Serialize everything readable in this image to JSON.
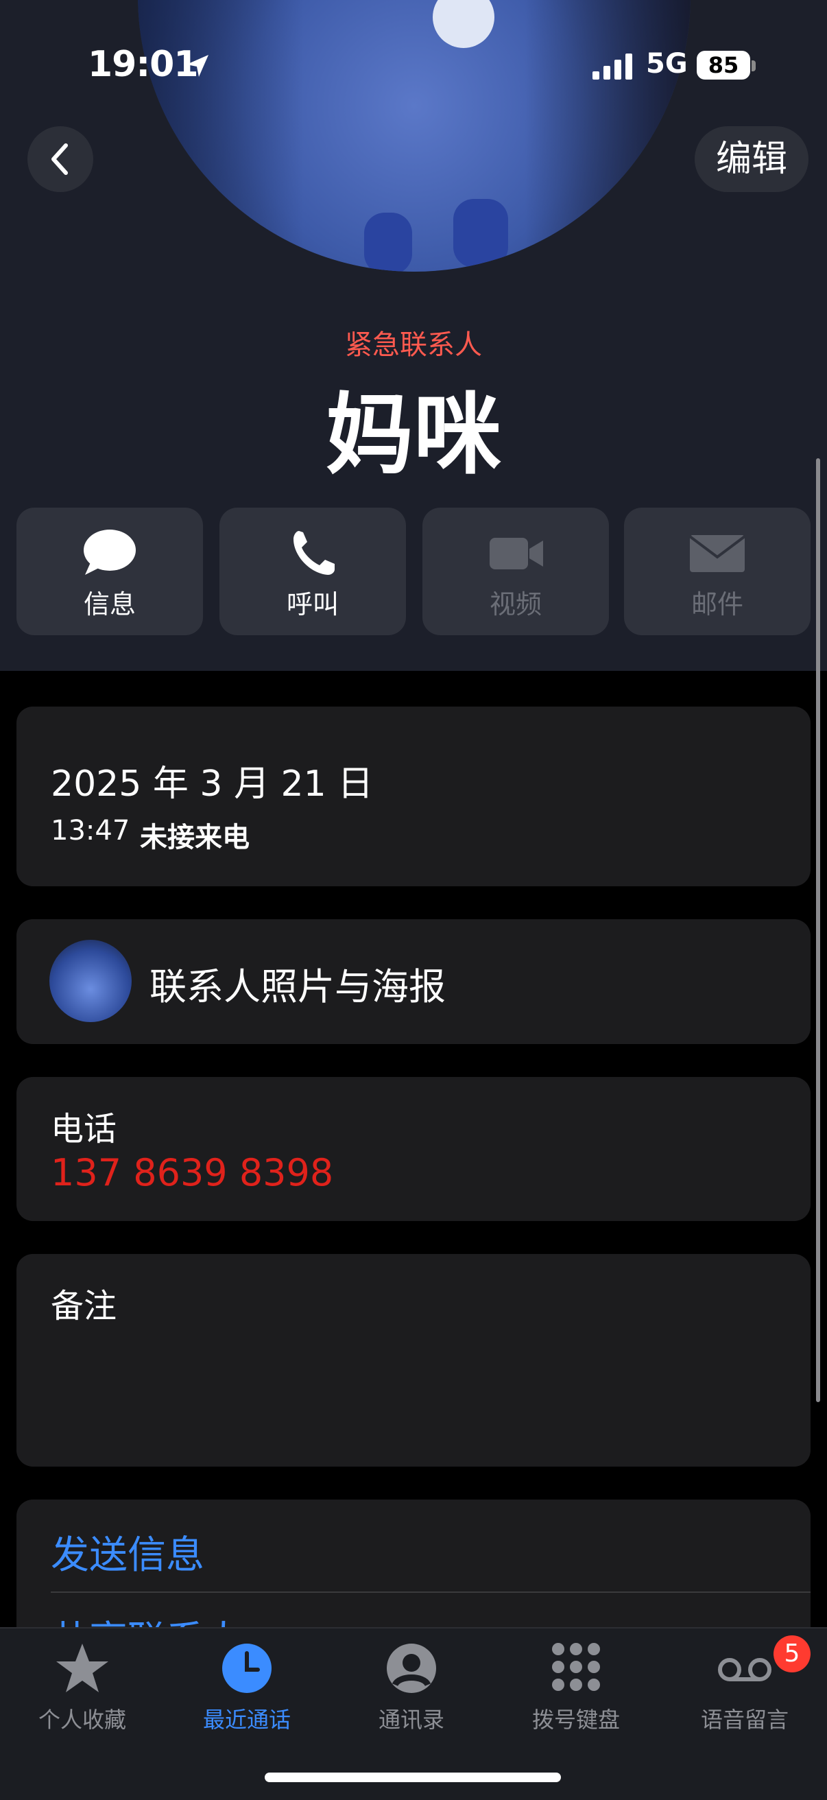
{
  "status_bar": {
    "time": "19:01",
    "network": "5G",
    "battery": "85"
  },
  "header": {
    "edit_label": "编辑",
    "emergency_label": "紧急联系人",
    "contact_name": "妈咪"
  },
  "actions": [
    {
      "label": "信息",
      "icon": "message-bubble-icon",
      "enabled": true
    },
    {
      "label": "呼叫",
      "icon": "phone-icon",
      "enabled": true
    },
    {
      "label": "视频",
      "icon": "video-camera-icon",
      "enabled": false
    },
    {
      "label": "邮件",
      "icon": "mail-icon",
      "enabled": false
    }
  ],
  "call_record": {
    "date": "2025 年 3 月 21 日",
    "time": "13:47",
    "type": "未接来电"
  },
  "photo_poster": {
    "label": "联系人照片与海报"
  },
  "phone": {
    "label": "电话",
    "number": "137 8639 8398",
    "color": "#e0221b"
  },
  "notes": {
    "label": "备注"
  },
  "links": {
    "send_message": "发送信息",
    "share_contact": "共享联系人"
  },
  "tab_bar": {
    "tabs": [
      {
        "label": "个人收藏",
        "icon": "star-icon",
        "active": false
      },
      {
        "label": "最近通话",
        "icon": "clock-icon",
        "active": true
      },
      {
        "label": "通讯录",
        "icon": "person-circle-icon",
        "active": false
      },
      {
        "label": "拨号键盘",
        "icon": "keypad-icon",
        "active": false
      },
      {
        "label": "语音留言",
        "icon": "voicemail-icon",
        "active": false
      }
    ],
    "voicemail_badge": "5",
    "accent_color": "#3b8cff"
  }
}
